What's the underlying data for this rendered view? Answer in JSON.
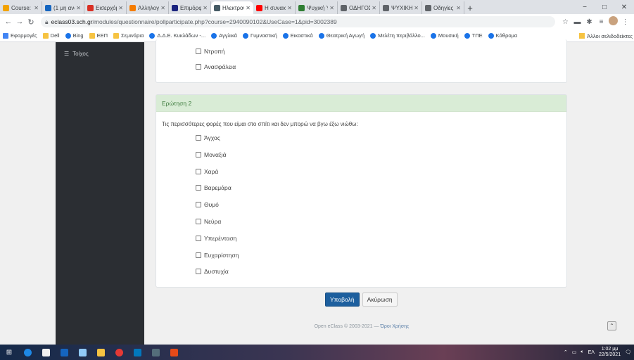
{
  "browser": {
    "tabs": [
      {
        "label": "Course: Σχ",
        "color": "#f2a200",
        "active": false
      },
      {
        "label": "(1 μη ανα",
        "color": "#1565c0",
        "active": false
      },
      {
        "label": "Εισερχόμ",
        "color": "#d93025",
        "active": false
      },
      {
        "label": "Αλληλογρ",
        "color": "#f57c00",
        "active": false
      },
      {
        "label": "Επιμόρφ",
        "color": "#1a237e",
        "active": false
      },
      {
        "label": "Ηλεκτρον",
        "color": "#455a64",
        "active": true
      },
      {
        "label": "Η συναισθ",
        "color": "#ff0000",
        "active": false
      },
      {
        "label": "Ψυχική Υγ",
        "color": "#2e7d32",
        "active": false
      },
      {
        "label": "ΟΔΗΓΟΣ Γ",
        "color": "#5f6368",
        "active": false
      },
      {
        "label": "ΨΥΧΙΚΗ Δ",
        "color": "#5f6368",
        "active": false
      },
      {
        "label": "Οδηγίες γ",
        "color": "#5f6368",
        "active": false
      }
    ],
    "new_tab": "+",
    "window_controls": {
      "minimize": "−",
      "maximize": "□",
      "close": "✕"
    },
    "url_host": "eclass03.sch.gr",
    "url_path": "/modules/questionnaire/pollparticipate.php?course=2940090102&UseCase=1&pid=3002389",
    "bookmarks": [
      {
        "label": "Εφαρμογές",
        "icon": "apps"
      },
      {
        "label": "Dell",
        "icon": "folder"
      },
      {
        "label": "Bing",
        "icon": "globe"
      },
      {
        "label": "ΕΕΠ",
        "icon": "folder"
      },
      {
        "label": "Σεμινάρια",
        "icon": "folder"
      },
      {
        "label": "Δ.Δ.Ε. Κυκλάδων -...",
        "icon": "globe"
      },
      {
        "label": "Αγγλικά",
        "icon": "globe"
      },
      {
        "label": "Γυμναστική",
        "icon": "globe"
      },
      {
        "label": "Εικαστικά",
        "icon": "globe"
      },
      {
        "label": "Θεατρική Αγωγή",
        "icon": "globe"
      },
      {
        "label": "Μελέτη περιβάλλο...",
        "icon": "globe"
      },
      {
        "label": "Μουσική",
        "icon": "globe"
      },
      {
        "label": "ΤΠΕ",
        "icon": "globe"
      },
      {
        "label": "Κάθρομα",
        "icon": "globe"
      }
    ],
    "other_bookmarks": "Άλλοι σελιδοδείκτες"
  },
  "sidebar": {
    "item_label": "Τοίχος",
    "item_icon": "list-icon"
  },
  "prev_question": {
    "options": [
      "Ντροπή",
      "Ανασφάλεια"
    ]
  },
  "question": {
    "header": "Ερώτηση 2",
    "text": "Τις περισσότερες φορές που είμαι στο σπίτι και δεν μπορώ να βγω έξω νιώθω:",
    "options": [
      "Άγχος",
      "Μοναξιά",
      "Χαρά",
      "Βαρεμάρα",
      "Θυμό",
      "Νεύρα",
      "Υπερένταση",
      "Ευχαρίστηση",
      "Δυστυχία"
    ]
  },
  "actions": {
    "submit": "Υποβολή",
    "cancel": "Ακύρωση"
  },
  "footer": {
    "copyright": "Open eClass © 2003-2021 — ",
    "terms": "Όροι Χρήσης"
  },
  "taskbar": {
    "time": "1:02 μμ",
    "date": "22/5/2021",
    "lang": "ΕΛ"
  },
  "colors": {
    "sidebar": "#2b2e33",
    "panel_header": "#d9ecd6",
    "primary_button": "#1d5f9e"
  }
}
